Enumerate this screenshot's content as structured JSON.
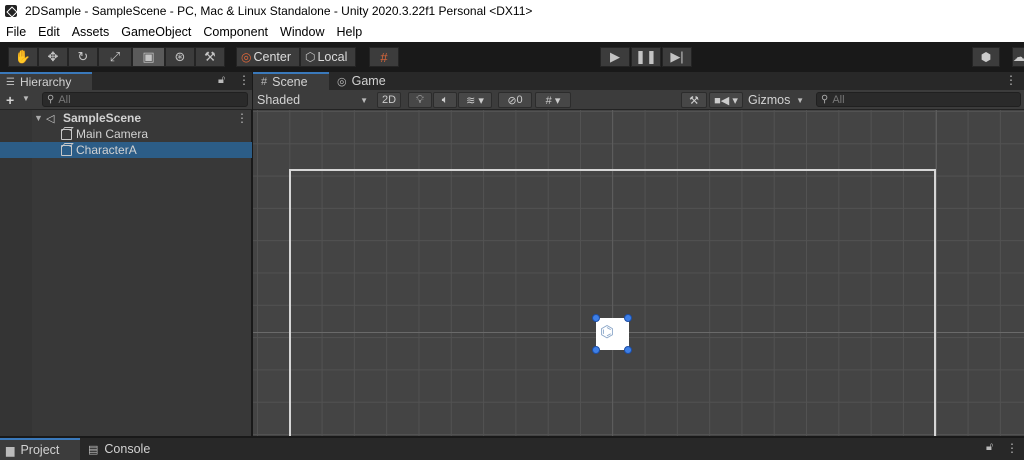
{
  "window": {
    "title": "2DSample - SampleScene - PC, Mac & Linux Standalone - Unity 2020.3.22f1 Personal <DX11>"
  },
  "menu": [
    "File",
    "Edit",
    "Assets",
    "GameObject",
    "Component",
    "Window",
    "Help"
  ],
  "toolbar": {
    "pivot_label": "Center",
    "space_label": "Local"
  },
  "hierarchy": {
    "tab_label": "Hierarchy",
    "search_placeholder": "All",
    "scene_name": "SampleScene",
    "items": [
      "Main Camera",
      "CharacterA"
    ],
    "selected": "CharacterA"
  },
  "scene_view": {
    "tabs": [
      "Scene",
      "Game"
    ],
    "shading_mode": "Shaded",
    "mode_2d_label": "2D",
    "hidden_count": "0",
    "gizmos_label": "Gizmos",
    "search_placeholder": "All"
  },
  "bottom_panel": {
    "tabs": [
      "Project",
      "Console"
    ]
  },
  "colors": {
    "selection": "#2c5d87",
    "tab_accent": "#3a79bb",
    "handle": "#3e7fe6"
  }
}
